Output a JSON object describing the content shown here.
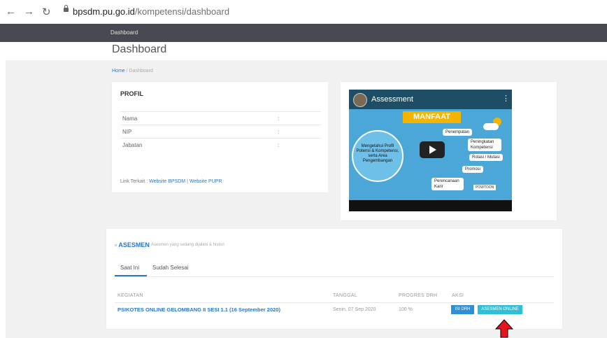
{
  "browser": {
    "url_host": "bpsdm.pu.go.id",
    "url_path": "/kompetensi/dashboard"
  },
  "nav": {
    "item": "Dashboard"
  },
  "page": {
    "title": "Dashboard"
  },
  "breadcrumb": {
    "home": "Home",
    "sep": "/",
    "current": "Dashboard"
  },
  "profil": {
    "title": "PROFIL",
    "rows": [
      {
        "label": "Nama",
        "value": ":"
      },
      {
        "label": "NIP",
        "value": ":"
      },
      {
        "label": "Jabatan",
        "value": ":"
      }
    ],
    "links_label": "Link Terkait : ",
    "link1": "Website BPSDM",
    "link_sep": " | ",
    "link2": "Website PUPR"
  },
  "video": {
    "title": "Assessment",
    "heading": "MANFAAT",
    "center_text": "Mengetahui Profil Potensi & Kompetensi, serta Area Pengembangan",
    "items": [
      "Penempatan",
      "Peningkatan Kompetensi",
      "Rotasi / Mutasi",
      "Promosi",
      "Perencanaan Karir"
    ],
    "brand": "POWTOON"
  },
  "asesmen": {
    "title": "ASESMEN",
    "subtitle": "Asesmen yang sedang dijalani & histori",
    "tabs": [
      "Saat Ini",
      "Sudah Selesai"
    ],
    "columns": [
      "KEGIATAN",
      "TANGGAL",
      "PROGRES DRH",
      "AKSI"
    ],
    "rows": [
      {
        "kegiatan": "PSIKOTES ONLINE GELOMBANG II SESI 1.1 (16 September 2020)",
        "tanggal": "Senin, 07 Sep 2020",
        "progres": "100 %",
        "btn_drh": "ISI DRH",
        "btn_online": "ASESMEN ONLINE"
      }
    ]
  },
  "colors": {
    "accent": "#2b77c7",
    "navbar": "#474a50",
    "btn_drh": "#2f8fd6",
    "btn_online": "#2fc0d8",
    "arrow": "#e8141b"
  }
}
